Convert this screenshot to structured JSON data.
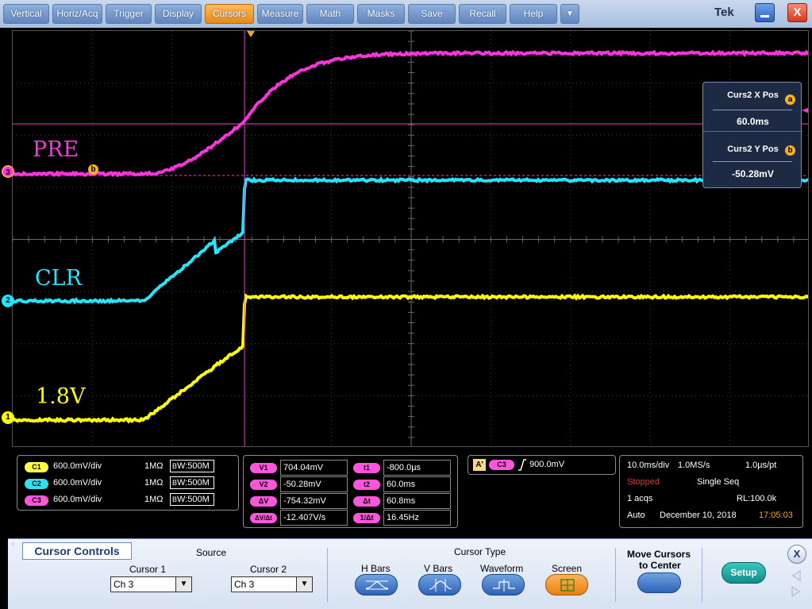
{
  "menu": {
    "items": [
      "Vertical",
      "Horiz/Acq",
      "Trigger",
      "Display",
      "Cursors",
      "Measure",
      "Math",
      "Masks",
      "Save",
      "Recall",
      "Help"
    ],
    "active": "Cursors",
    "more_glyph": "▼",
    "brand": "Tek",
    "close_glyph": "X"
  },
  "screen": {
    "channel_labels": {
      "pre": "PRE",
      "clr": "CLR",
      "v18": "1.8V"
    },
    "markers": {
      "c3": "3",
      "c2": "2",
      "c1": "1"
    },
    "colors": {
      "ch1": "#ffff00",
      "ch2": "#22e6ff",
      "ch3": "#ff33dd",
      "cursor": "#ff33dd",
      "trigger": "#f5a623"
    },
    "cursor_popup": {
      "x_title": "Curs2 X Pos",
      "x_knob": "a",
      "x_value": "60.0ms",
      "y_title": "Curs2 Y Pos",
      "y_knob": "b",
      "y_value": "-50.28mV"
    },
    "waveform_cursor_knob": "b"
  },
  "channels": [
    {
      "tag": "C1",
      "scale": "600.0mV/div",
      "imp": "1MΩ",
      "bw": "W:500M",
      "color": "#ffff44"
    },
    {
      "tag": "C2",
      "scale": "600.0mV/div",
      "imp": "1MΩ",
      "bw": "W:500M",
      "color": "#33e0f0"
    },
    {
      "tag": "C3",
      "scale": "600.0mV/div",
      "imp": "1MΩ",
      "bw": "W:500M",
      "color": "#ff55dd"
    }
  ],
  "cursor_readout": {
    "v1": {
      "label": "V1",
      "value": "704.04mV"
    },
    "v2": {
      "label": "V2",
      "value": "-50.28mV"
    },
    "dv": {
      "label": "ΔV",
      "value": "-754.32mV"
    },
    "dvdt": {
      "label": "ΔV/Δt",
      "value": "-12.407V/s"
    },
    "t1": {
      "label": "t1",
      "value": "-800.0µs"
    },
    "t2": {
      "label": "t2",
      "value": "60.0ms"
    },
    "dt": {
      "label": "Δt",
      "value": "60.8ms"
    },
    "inv_dt": {
      "label": "1/Δt",
      "value": "16.45Hz"
    }
  },
  "trigger": {
    "badge": "A'",
    "channel": "C3",
    "level": "900.0mV"
  },
  "acquisition": {
    "timebase": "10.0ms/div",
    "sample_rate": "1.0MS/s",
    "resolution": "1.0µs/pt",
    "state": "Stopped",
    "mode": "Single Seq",
    "acqs": "1 acqs",
    "record_length": "RL:100.0k",
    "trigger_mode": "Auto",
    "date": "December 10, 2018",
    "time": "17:05:03"
  },
  "controls": {
    "title": "Cursor Controls",
    "source_label": "Source",
    "cursor1_label": "Cursor 1",
    "cursor1_value": "Ch 3",
    "cursor2_label": "Cursor 2",
    "cursor2_value": "Ch 3",
    "dropdown_glyph": "▼",
    "type_label": "Cursor Type",
    "types": [
      "H Bars",
      "V Bars",
      "Waveform",
      "Screen"
    ],
    "active_type": "Screen",
    "move_label_1": "Move Cursors",
    "move_label_2": "to Center",
    "setup_label": "Setup",
    "close_glyph": "X"
  }
}
